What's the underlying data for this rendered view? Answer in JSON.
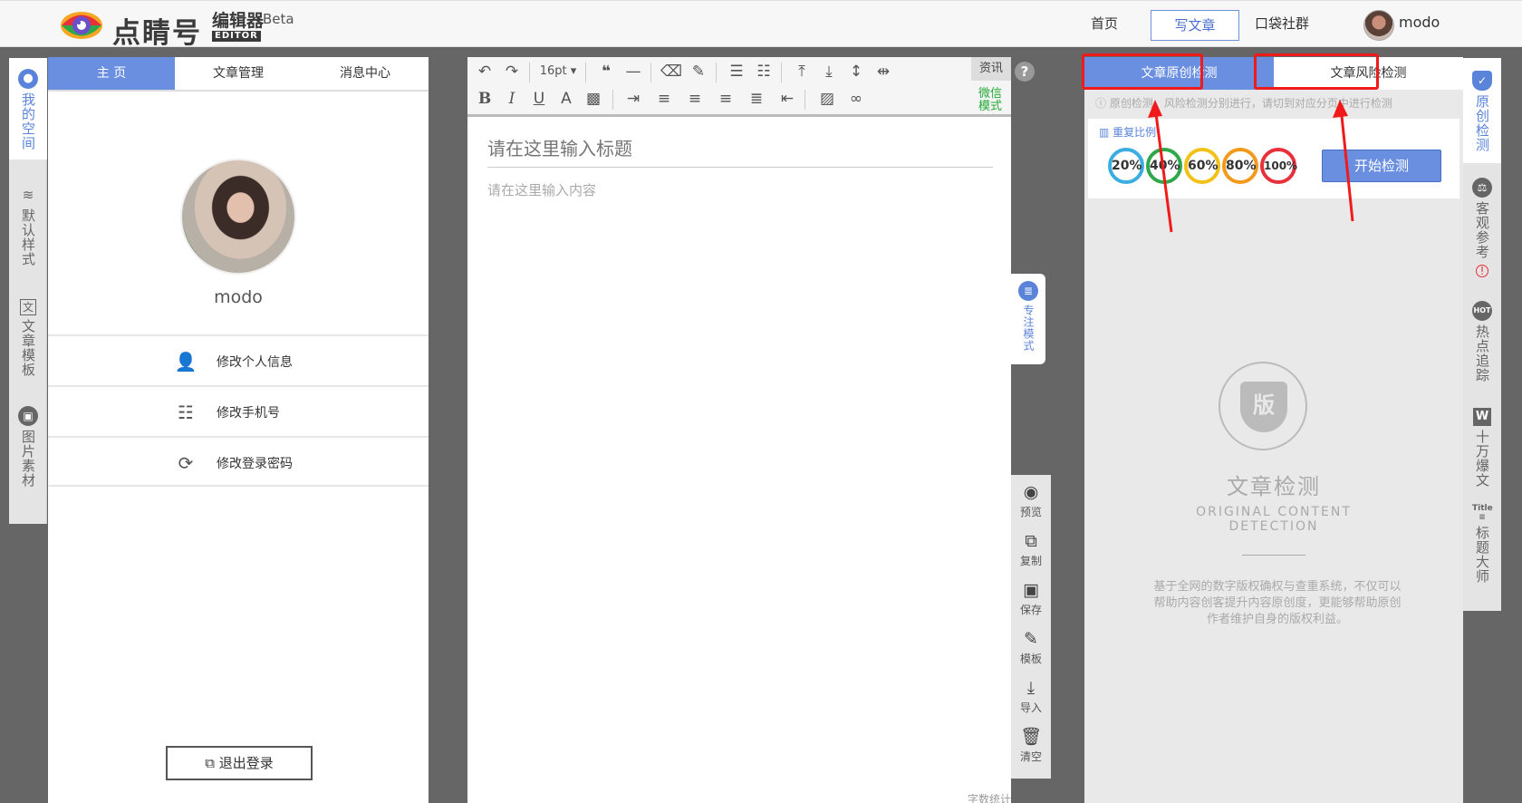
{
  "header": {
    "logo_name": "点睛号",
    "logo_sub": "编辑器",
    "logo_editor": "EDITOR",
    "logo_beta": "Beta",
    "nav": [
      "首页",
      "写文章",
      "口袋社群"
    ],
    "username": "modo"
  },
  "left_rail": {
    "items": [
      {
        "label": "我的空间",
        "icon": "user-icon",
        "active": true
      },
      {
        "label": "默认样式",
        "icon": "layers-icon"
      },
      {
        "label": "文章模板",
        "icon": "template-icon"
      },
      {
        "label": "图片素材",
        "icon": "image-icon"
      }
    ]
  },
  "profile": {
    "tabs": [
      "主 页",
      "文章管理",
      "消息中心"
    ],
    "username": "modo",
    "menu": [
      {
        "label": "修改个人信息",
        "icon": "profile-edit-icon"
      },
      {
        "label": "修改手机号",
        "icon": "phone-list-icon"
      },
      {
        "label": "修改登录密码",
        "icon": "lock-refresh-icon"
      }
    ],
    "logout_label": "退出登录"
  },
  "editor": {
    "font_size": "16pt",
    "news_label": "资讯",
    "wechat_mode": "微信模式",
    "title_placeholder": "请在这里输入标题",
    "content_placeholder": "请在这里输入内容",
    "word_count": "字数统计",
    "focus_mode": "专注模式"
  },
  "actions": [
    {
      "label": "预览",
      "icon": "eye-icon"
    },
    {
      "label": "复制",
      "icon": "copy-icon"
    },
    {
      "label": "保存",
      "icon": "save-icon"
    },
    {
      "label": "模板",
      "icon": "template-edit-icon"
    },
    {
      "label": "导入",
      "icon": "import-icon"
    },
    {
      "label": "清空",
      "icon": "trash-icon"
    }
  ],
  "detect": {
    "tabs": [
      "文章原创检测",
      "文章风险检测"
    ],
    "hint": "原创检测、风险检测分别进行，请切到对应分页中进行检测",
    "ratio_label": "重复比例",
    "ratios": [
      {
        "value": "20%",
        "color": "#3aaee0"
      },
      {
        "value": "40%",
        "color": "#2ea84a"
      },
      {
        "value": "60%",
        "color": "#f2c21b"
      },
      {
        "value": "80%",
        "color": "#f29a1b"
      },
      {
        "value": "100%",
        "color": "#e8303a"
      }
    ],
    "start_button": "开始检测",
    "badge": "版",
    "title": "文章检测",
    "en_line1": "ORIGINAL CONTENT",
    "en_line2": "DETECTION",
    "description": "基于全网的数字版权确权与查重系统，不仅可以帮助内容创客提升内容原创度，更能够帮助原创作者维护自身的版权利益。"
  },
  "right_rail": {
    "items": [
      {
        "label": "原创检测",
        "icon": "shield-check-icon",
        "active": true
      },
      {
        "label": "客观参考",
        "icon": "scale-icon"
      },
      {
        "label": "热点追踪",
        "icon": "hot-icon"
      },
      {
        "label": "十万爆文",
        "icon": "w-icon"
      },
      {
        "label": "标题大师",
        "icon": "title-icon"
      }
    ],
    "title_icon_text": "Title"
  },
  "colors": {
    "accent": "#6b8fe0",
    "annotation": "#f01a1a"
  }
}
